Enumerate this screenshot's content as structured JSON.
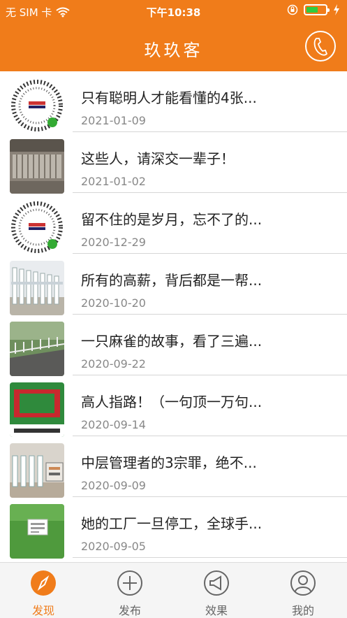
{
  "status_bar": {
    "carrier": "无 SIM 卡",
    "time": "下午10:38"
  },
  "header": {
    "title": "玖玖客"
  },
  "articles": [
    {
      "title": "只有聪明人才能看懂的4张...",
      "date": "2021-01-09",
      "thumb": "qr"
    },
    {
      "title": "这些人，请深交一辈子！",
      "date": "2021-01-02",
      "thumb": "rail"
    },
    {
      "title": "留不住的是岁月，忘不了的...",
      "date": "2020-12-29",
      "thumb": "qr"
    },
    {
      "title": "所有的高薪，背后都是一帮...",
      "date": "2020-10-20",
      "thumb": "fence"
    },
    {
      "title": "一只麻雀的故事，看了三遍...",
      "date": "2020-09-22",
      "thumb": "road"
    },
    {
      "title": "高人指路！（一句顶一万句...",
      "date": "2020-09-14",
      "thumb": "sign"
    },
    {
      "title": "中层管理者的3宗罪，绝不...",
      "date": "2020-09-09",
      "thumb": "fence2"
    },
    {
      "title": "她的工厂一旦停工，全球手...",
      "date": "2020-09-05",
      "thumb": "grass"
    }
  ],
  "tabs": [
    {
      "label": "发现",
      "icon": "compass-icon"
    },
    {
      "label": "发布",
      "icon": "plus-circle-icon"
    },
    {
      "label": "效果",
      "icon": "megaphone-icon"
    },
    {
      "label": "我的",
      "icon": "user-icon"
    }
  ],
  "colors": {
    "accent": "#f07c1a",
    "battery": "#2ecc40"
  }
}
